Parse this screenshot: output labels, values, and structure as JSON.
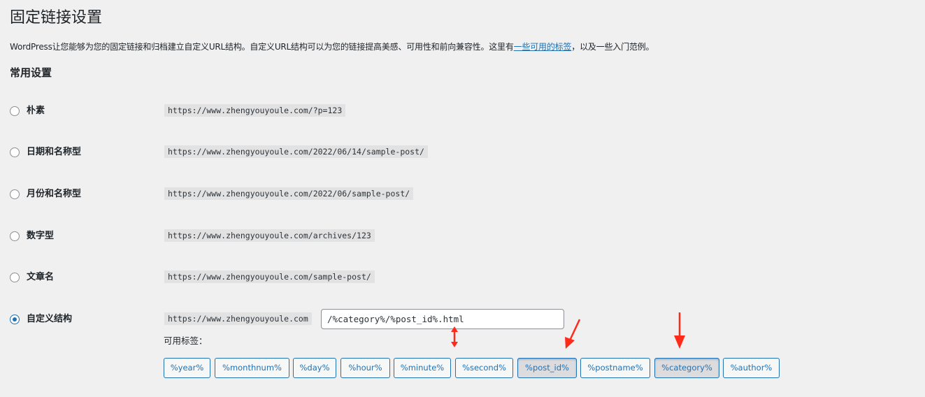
{
  "page": {
    "title": "固定链接设置",
    "intro_before": "WordPress让您能够为您的固定链接和归档建立自定义URL结构。自定义URL结构可以为您的链接提高美感、可用性和前向兼容性。这里有",
    "intro_link": "一些可用的标签",
    "intro_after": "，以及一些入门范例。",
    "section_title": "常用设置"
  },
  "options": [
    {
      "label": "朴素",
      "url": "https://www.zhengyouyoule.com/?p=123",
      "checked": false
    },
    {
      "label": "日期和名称型",
      "url": "https://www.zhengyouyoule.com/2022/06/14/sample-post/",
      "checked": false
    },
    {
      "label": "月份和名称型",
      "url": "https://www.zhengyouyoule.com/2022/06/sample-post/",
      "checked": false
    },
    {
      "label": "数字型",
      "url": "https://www.zhengyouyoule.com/archives/123",
      "checked": false
    },
    {
      "label": "文章名",
      "url": "https://www.zhengyouyoule.com/sample-post/",
      "checked": false
    },
    {
      "label": "自定义结构",
      "url": "https://www.zhengyouyoule.com",
      "checked": true
    }
  ],
  "custom": {
    "value": "/%category%/%post_id%.html",
    "tags_label": "可用标签："
  },
  "tags": [
    {
      "label": "%year%",
      "active": false
    },
    {
      "label": "%monthnum%",
      "active": false
    },
    {
      "label": "%day%",
      "active": false
    },
    {
      "label": "%hour%",
      "active": false
    },
    {
      "label": "%minute%",
      "active": false
    },
    {
      "label": "%second%",
      "active": false
    },
    {
      "label": "%post_id%",
      "active": true
    },
    {
      "label": "%postname%",
      "active": false
    },
    {
      "label": "%category%",
      "active": true
    },
    {
      "label": "%author%",
      "active": false
    }
  ],
  "colors": {
    "accent": "#2271b1",
    "annotation_arrow": "#ff2a1a",
    "background": "#f0f0f1"
  }
}
